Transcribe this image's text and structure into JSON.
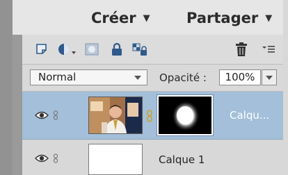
{
  "topbar": {
    "create_label": "Créer",
    "share_label": "Partager"
  },
  "toolbar": {
    "icons": [
      "new-layer-icon",
      "adjustment-layer-icon",
      "add-mask-icon",
      "lock-icon",
      "lock-transparency-icon",
      "trash-icon",
      "panel-menu-icon"
    ]
  },
  "blend": {
    "mode": "Normal",
    "opacity_label": "Opacité :",
    "opacity_value": "100%"
  },
  "layers": [
    {
      "name": "Calqu...",
      "selected": true,
      "has_mask": true
    },
    {
      "name": "Calque 1",
      "selected": false,
      "has_mask": false
    }
  ],
  "colors": {
    "selected_row": "#a3bfd9",
    "panel_bg": "#d4d4d4",
    "topbar_bg": "#e6e6e6"
  }
}
